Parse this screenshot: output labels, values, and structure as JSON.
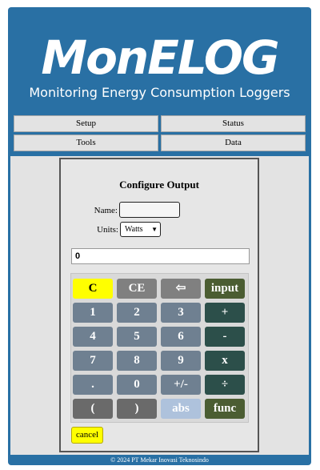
{
  "header": {
    "logo": "MonELOG",
    "tagline": "Monitoring Energy Consumption Loggers"
  },
  "nav": {
    "setup": "Setup",
    "status": "Status",
    "tools": "Tools",
    "data": "Data"
  },
  "form": {
    "title": "Configure Output",
    "name_label": "Name:",
    "name_value": "",
    "units_label": "Units:",
    "units_value": "Watts"
  },
  "calculator": {
    "display": "0",
    "keys": [
      [
        "C",
        "CE",
        "⇦",
        "input"
      ],
      [
        "1",
        "2",
        "3",
        "+"
      ],
      [
        "4",
        "5",
        "6",
        "-"
      ],
      [
        "7",
        "8",
        "9",
        "x"
      ],
      [
        ".",
        "0",
        "+/-",
        "÷"
      ],
      [
        "(",
        ")",
        "abs",
        "func"
      ]
    ]
  },
  "cancel_label": "cancel",
  "footer": "© 2024 PT Mekar Inovasi Teknosindo",
  "colors": {
    "brand": "#2970a4",
    "key_yellow": "#ffff00",
    "key_teal": "#2c4f4a",
    "key_green": "#4b5d32"
  }
}
